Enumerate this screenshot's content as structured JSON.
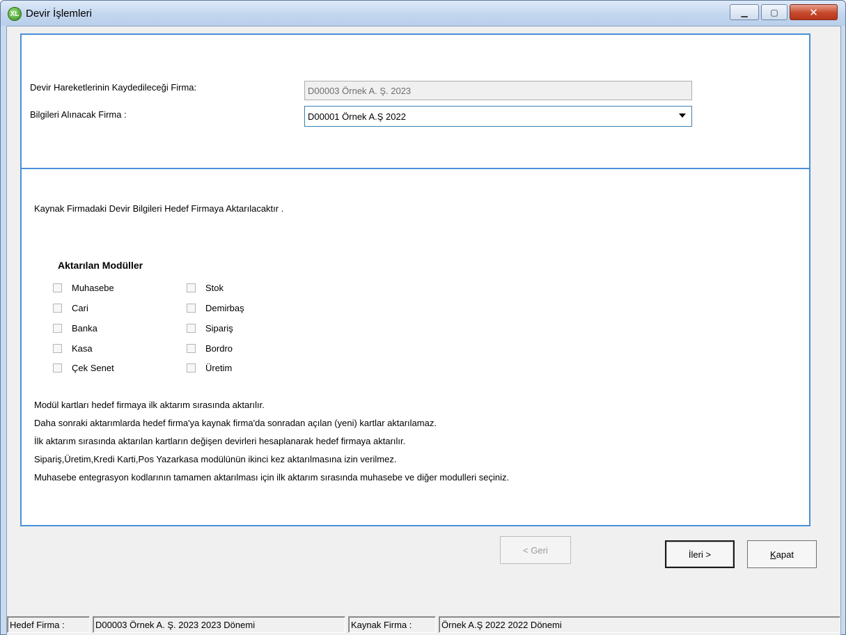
{
  "window": {
    "title": "Devir İşlemleri",
    "app_icon_glyph": "XL"
  },
  "form": {
    "target_label": "Devir Hareketlerinin Kaydedileceği Firma:",
    "target_value": "D00003 Örnek A. Ş. 2023",
    "source_label": "Bilgileri Alınacak Firma :",
    "source_value": "D00001 Örnek A.Ş 2022"
  },
  "info_line": "Kaynak Firmadaki Devir Bilgileri Hedef Firmaya  Aktarılacaktır .",
  "modules": {
    "title": "Aktarılan Modüller",
    "left": [
      {
        "label": "Muhasebe",
        "checked": false
      },
      {
        "label": "Cari",
        "checked": false
      },
      {
        "label": "Banka",
        "checked": false
      },
      {
        "label": "Kasa",
        "checked": false
      },
      {
        "label": "Çek Senet",
        "checked": false
      }
    ],
    "right": [
      {
        "label": "Stok",
        "checked": false
      },
      {
        "label": "Demirbaş",
        "checked": false
      },
      {
        "label": "Sipariş",
        "checked": false
      },
      {
        "label": "Bordro",
        "checked": false
      },
      {
        "label": "Üretim",
        "checked": false
      }
    ]
  },
  "notes": [
    "Modül kartları  hedef firmaya ilk aktarım sırasında  aktarılır.",
    "Daha sonraki aktarımlarda hedef firma'ya kaynak firma'da sonradan açılan  (yeni)  kartlar aktarılamaz.",
    "İlk aktarım sırasında aktarılan kartların değişen devirleri hesaplanarak hedef firmaya aktarılır.",
    "Sipariş,Üretim,Kredi Karti,Pos Yazarkasa  modülünün ikinci kez aktarılmasına izin verilmez.",
    "Muhasebe entegrasyon kodlarının tamamen aktarılması için ilk aktarım sırasında muhasebe ve diğer modulleri seçiniz."
  ],
  "buttons": {
    "back": "< Geri",
    "next": "İleri >",
    "close_first": "K",
    "close_rest": "apat"
  },
  "status": {
    "target_label": "Hedef Firma :",
    "target_value": "D00003 Örnek A. Ş. 2023 2023 Dönemi",
    "source_label": "Kaynak Firma :",
    "source_value": "Örnek A.Ş 2022  2022 Dönemi"
  },
  "colors": {
    "panel_border": "#4a90d9",
    "close_button": "#c6492c"
  }
}
